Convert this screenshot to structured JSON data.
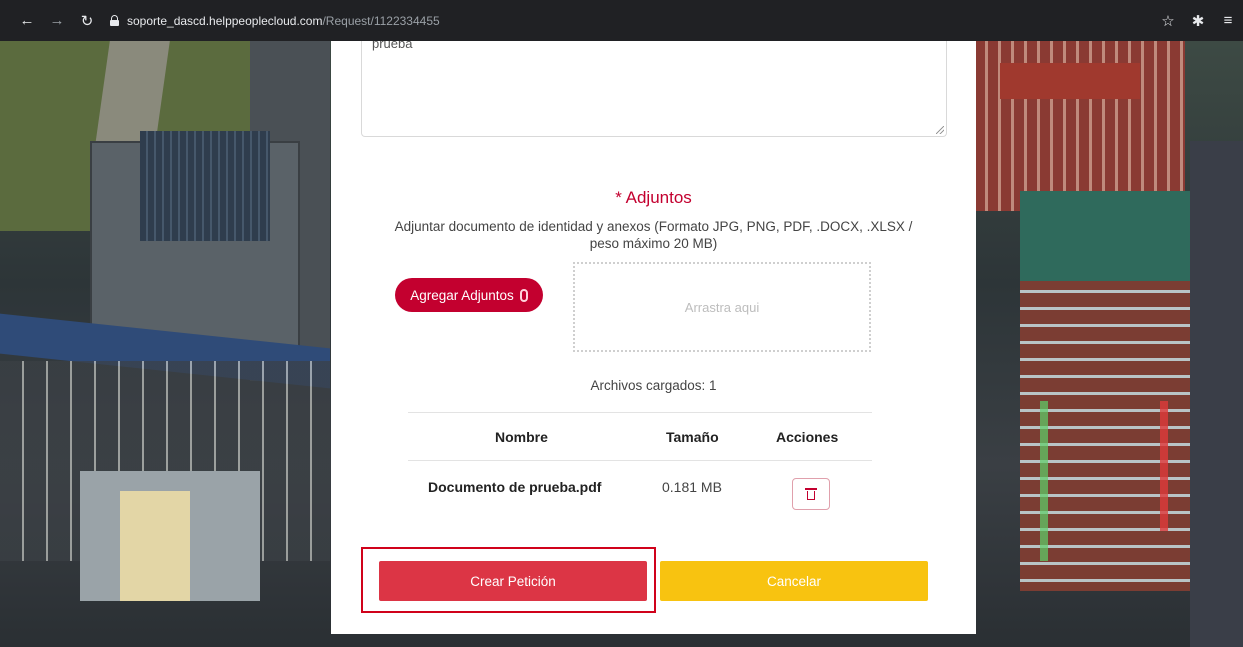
{
  "browser": {
    "url_host": "soporte_dascd.helppeoplecloud.com",
    "url_path": "/Request/1122334455",
    "icons": [
      "back-arrow-icon",
      "forward-arrow-icon",
      "reload-icon",
      "lock-icon",
      "star-icon",
      "extensions-icon",
      "menu-icon"
    ]
  },
  "form": {
    "textarea_value": "prueba",
    "attachments": {
      "title": "* Adjuntos",
      "help": "Adjuntar documento de identidad y anexos (Formato JPG, PNG, PDF, .DOCX, .XLSX / peso máximo 20 MB)",
      "add_label": "Agregar Adjuntos",
      "drop_label": "Arrastra aqui",
      "files_count": "Archivos cargados: 1"
    },
    "table": {
      "headers": [
        "Nombre",
        "Tamaño",
        "Acciones"
      ],
      "rows": [
        {
          "name": "Documento de prueba.pdf",
          "size": "0.181 MB"
        }
      ]
    },
    "actions": {
      "create_label": "Crear Petición",
      "cancel_label": "Cancelar"
    }
  },
  "colors": {
    "brand_red": "#c3002f",
    "create_red": "#dc3545",
    "cancel_yellow": "#f8c310",
    "highlight": "#d0021b"
  }
}
